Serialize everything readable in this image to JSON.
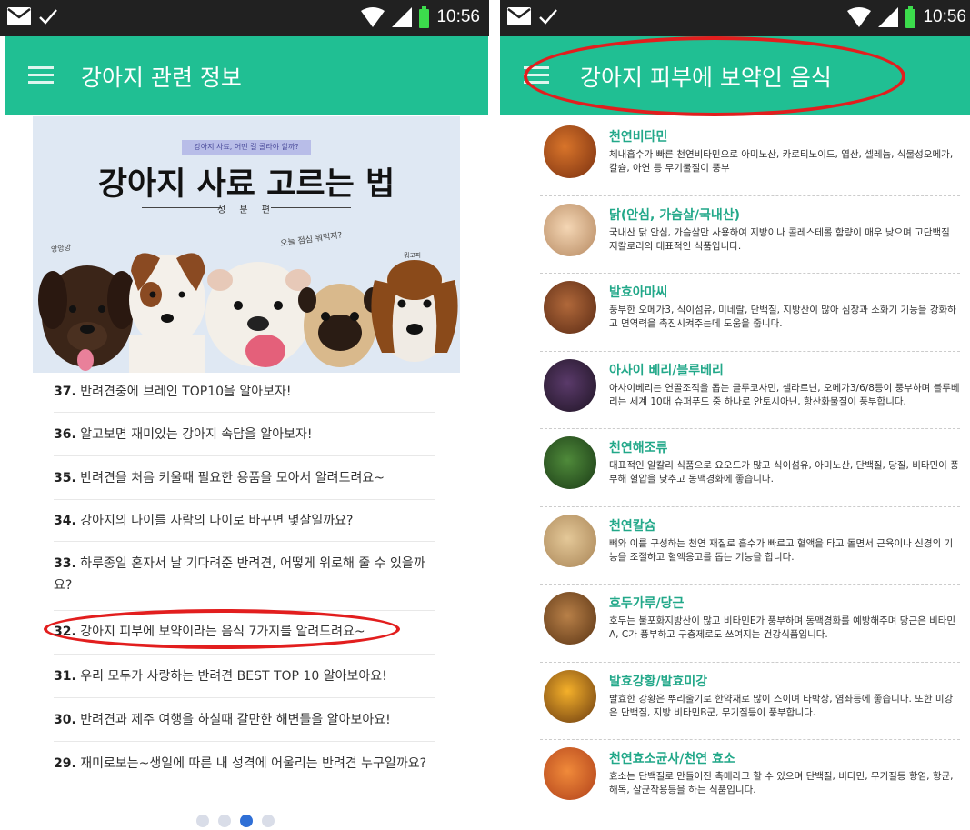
{
  "left_screen": {
    "status": {
      "time": "10:56"
    },
    "app_bar": {
      "title": "강아지 관련 정보"
    },
    "hero": {
      "tag": "강아지 사료, 어떤 걸 골라야 할까?",
      "title": "강아지 사료 고르는 법",
      "subtitle": "성 분 편",
      "note_left": "앙앙앙",
      "note_mid": "오늘 점심 뭐먹지?",
      "note_right": "뭐고파"
    },
    "articles": [
      {
        "num": "37.",
        "title": "반려견중에 브레인 TOP10을 알아보자!"
      },
      {
        "num": "36.",
        "title": "알고보면 재미있는 강아지 속담을 알아보자!"
      },
      {
        "num": "35.",
        "title": "반려견을 처음 키울때 필요한 용품을 모아서 알려드려요~"
      },
      {
        "num": "34.",
        "title": "강아지의 나이를 사람의 나이로 바꾸면 몇살일까요?"
      },
      {
        "num": "33.",
        "title": "하루종일 혼자서 날 기다려준 반려견, 어떻게 위로해 줄 수 있을까요?"
      },
      {
        "num": "32.",
        "title": "강아지 피부에 보약이라는 음식 7가지를 알려드려요~"
      },
      {
        "num": "31.",
        "title": "우리 모두가 사랑하는 반려견 BEST TOP 10 알아보아요!"
      },
      {
        "num": "30.",
        "title": "반려견과 제주 여행을 하실때 갈만한 해변들을 알아보아요!"
      },
      {
        "num": "29.",
        "title": "재미로보는~생일에 따른 내 성격에 어울리는 반려견 누구일까요?"
      }
    ],
    "pager": {
      "count": 4,
      "active_index": 2
    }
  },
  "right_screen": {
    "status": {
      "time": "10:56"
    },
    "app_bar": {
      "title": "강아지 피부에 보약인 음식"
    },
    "foods": [
      {
        "name": "천연비타민",
        "desc": "체내흡수가 빠른 천연비타민으로 아미노산, 카로티노이드, 엽산, 셀레늄, 식물성오메가, 칼슘, 아연 등 무기물질이 풍부",
        "color": "#b4521f"
      },
      {
        "name": "닭(안심, 가슴살/국내산)",
        "desc": "국내산 닭 안심, 가슴살만 사용하여 지방이나 콜레스테롤 함량이 매우 낮으며 고단백질 저칼로리의 대표적인 식품입니다.",
        "color": "#e8c49b"
      },
      {
        "name": "발효아마씨",
        "desc": "풍부한 오메가3, 식이섬유, 미네랄, 단백질, 지방산이 많아 심장과 소화기 기능을 강화하고 면역력을 촉진시켜주는데 도움을 줍니다.",
        "color": "#8a4a2a"
      },
      {
        "name": "아사이 베리/블루베리",
        "desc": "아사이베리는 연골조직을 돕는 글루코사민, 셀라르닌, 오메가3/6/8등이 풍부하며 블루베리는 세계 10대 슈퍼푸드 중 하나로 안토시아닌, 항산화물질이 풍부합니다.",
        "color": "#3a2a4a"
      },
      {
        "name": "천연해조류",
        "desc": "대표적인 알칼리 식품으로 요오드가 많고 식이섬유, 아미노산, 단백질, 당질, 비타민이 풍부해 혈압을 낮추고 동맥경화에 좋습니다.",
        "color": "#2f5a2a"
      },
      {
        "name": "천연칼슘",
        "desc": "뼈와 이를 구성하는 천연 재질로 흡수가 빠르고 혈액을 타고 돌면서 근육이나 신경의 기능을 조절하고 혈액응고를 돕는 기능을 합니다.",
        "color": "#c7a87a"
      },
      {
        "name": "호두가루/당근",
        "desc": "호두는 불포화지방산이 많고 비타민E가 풍부하며 동맥경화를 예방해주며 당근은 비타민A, C가 풍부하고 구충제로도 쓰여지는 건강식품입니다.",
        "color": "#8a5a2a"
      },
      {
        "name": "발효강황/발효미강",
        "desc": "발효한 강황은 뿌리줄기로 한약재로 많이 스이며 타박상, 염좌등에 좋습니다. 또한 미강은 단백질, 지방 비타민B군, 무기질등이 풍부합니다.",
        "color": "#e09a1a"
      },
      {
        "name": "천연효소균사/천연 효소",
        "desc": "효소는 단백질로 만들어진 촉매라고 할 수 있으며 단백질, 비타민, 무기질등 항염, 항균, 해독, 살균작용등을 하는 식품입니다.",
        "color": "#d8561a"
      }
    ]
  },
  "colors": {
    "status_bar": "#212121",
    "app_bar": "#20bf93",
    "food_title": "#22a889",
    "highlight": "#e21e1e",
    "pager_active": "#2f6fd6",
    "pager_inactive": "#d9dde8"
  },
  "icons": [
    "mail-icon",
    "check-icon",
    "wifi-icon",
    "signal-icon",
    "battery-icon",
    "hamburger-menu-icon"
  ]
}
